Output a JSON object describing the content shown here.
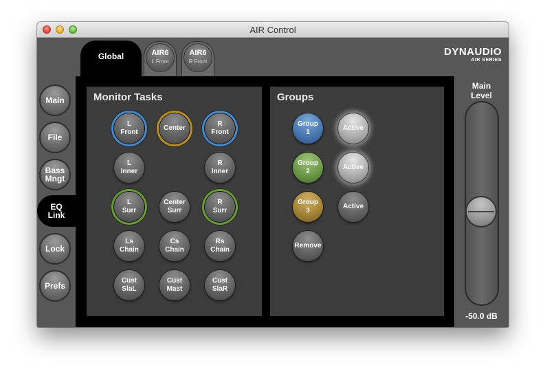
{
  "window": {
    "title": "AIR Control"
  },
  "tabs": {
    "global": "Global",
    "devices": [
      {
        "name": "AIR6",
        "position": "L Front"
      },
      {
        "name": "AIR6",
        "position": "R Front"
      }
    ]
  },
  "brand": {
    "logo": "DYNAUDIO",
    "sub": "AIR SERIES"
  },
  "sidebar": {
    "items": [
      {
        "label": "Main"
      },
      {
        "label": "File"
      },
      {
        "label": "Bass\nMngt"
      },
      {
        "label": "EQ\nLink",
        "active": true
      },
      {
        "label": "Lock"
      },
      {
        "label": "Prefs"
      }
    ]
  },
  "monitor_tasks": {
    "title": "Monitor Tasks",
    "buttons": [
      {
        "label": "L\nFront",
        "ring": "blue"
      },
      {
        "label": "Center",
        "ring": "gold"
      },
      {
        "label": "R\nFront",
        "ring": "blue"
      },
      {
        "label": "L\nInner"
      },
      {
        "label": "R\nInner"
      },
      {
        "label": "L\nSurr",
        "ring": "green"
      },
      {
        "label": "Center\nSurr"
      },
      {
        "label": "R\nSurr",
        "ring": "green"
      },
      {
        "label": "Ls\nChain"
      },
      {
        "label": "Cs\nChain"
      },
      {
        "label": "Rs\nChain"
      },
      {
        "label": "Cust\nSlaL"
      },
      {
        "label": "Cust\nMast"
      },
      {
        "label": "Cust\nSlaR"
      }
    ]
  },
  "groups": {
    "title": "Groups",
    "items": [
      {
        "label": "Group\n1",
        "color": "blue",
        "active_label": "Active",
        "active_lit": true
      },
      {
        "label": "Group\n2",
        "color": "green",
        "active_label": "Active",
        "active_lit": true
      },
      {
        "label": "Group\n3",
        "color": "gold",
        "active_label": "Active",
        "active_lit": false
      }
    ],
    "remove_label": "Remove"
  },
  "main_level": {
    "title": "Main\nLevel",
    "value": "-50.0 dB"
  },
  "colors": {
    "ring_blue": "#4a88c6",
    "ring_gold": "#b8902e",
    "ring_green": "#6b9a3e",
    "group_blue": "#4a78b0",
    "group_green": "#6e9a48",
    "group_gold": "#a48636"
  }
}
